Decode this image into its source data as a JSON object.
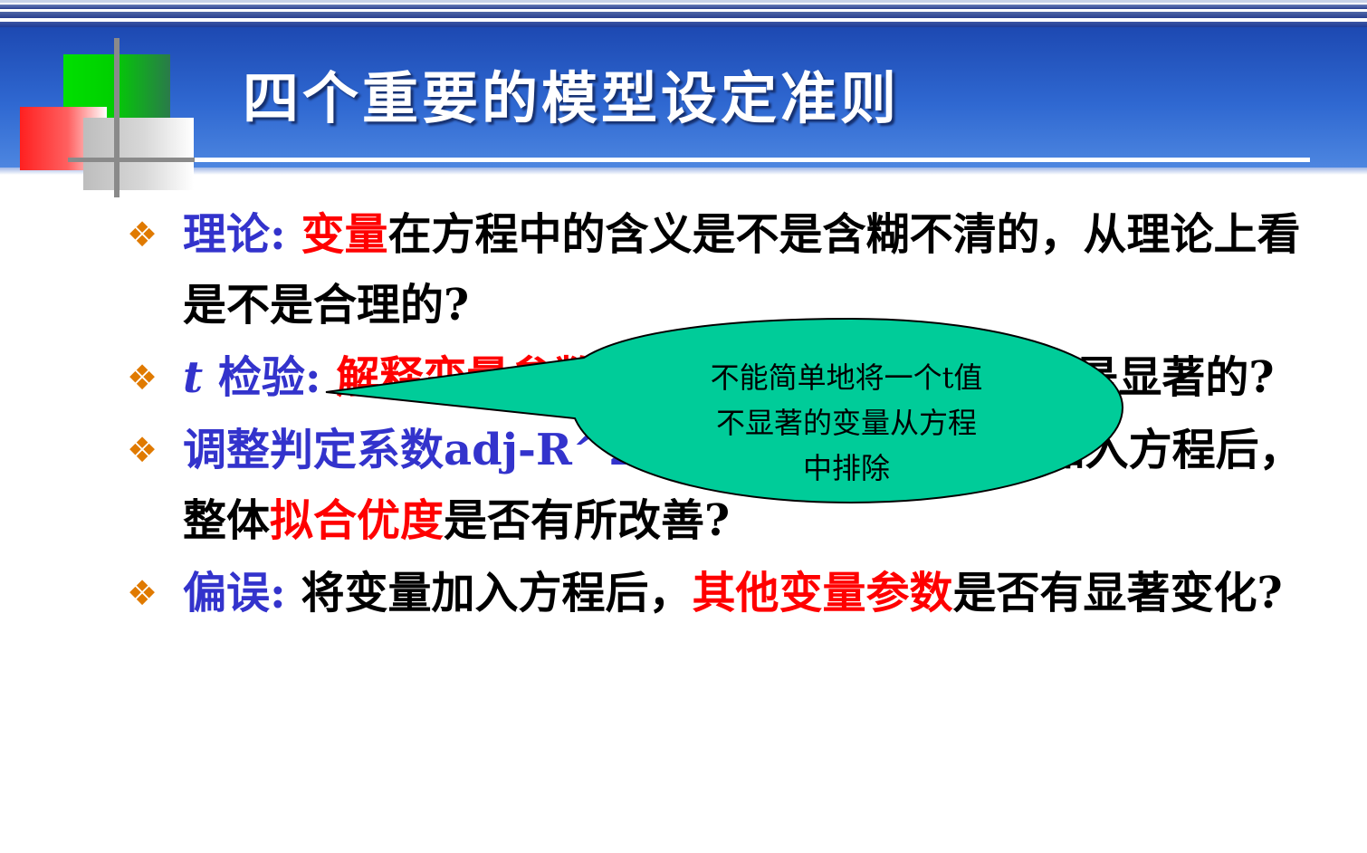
{
  "slide": {
    "title": "四个重要的模型设定准则"
  },
  "bullets": [
    {
      "label": "理论:",
      "parts": [
        {
          "text": "变量",
          "color": "red"
        },
        {
          "text": "在方程中的含义是不是含糊不清的，从理论上看是不是合理的?",
          "color": "black"
        }
      ]
    },
    {
      "label_italic": "t",
      "label": "检验:",
      "parts": [
        {
          "text": "解释变量参数",
          "color": "red"
        },
        {
          "text": "在预期符号的假设下是不是显著的?",
          "color": "black"
        }
      ]
    },
    {
      "label": "调整判定系数adj-R^2或AIC和SC:",
      "parts": [
        {
          "text": "将变量加入方程后，整体",
          "color": "black"
        },
        {
          "text": "拟合优度",
          "color": "red"
        },
        {
          "text": "是否有所改善?",
          "color": "black"
        }
      ]
    },
    {
      "label": "偏误:",
      "parts": [
        {
          "text": "将变量加入方程后，",
          "color": "black"
        },
        {
          "text": "其他变量参数",
          "color": "red"
        },
        {
          "text": "是否有显著变化?",
          "color": "black"
        }
      ]
    }
  ],
  "callout": {
    "line1": "不能简单地将一个t值",
    "line2": "不显著的变量从方程",
    "line3": "中排除",
    "fill": "#00cc99",
    "stroke": "#000000"
  },
  "colors": {
    "accent_blue": "#3333cc",
    "accent_red": "#ff0000",
    "bullet_mark": "#e07a00",
    "header": "#2f68d1"
  }
}
